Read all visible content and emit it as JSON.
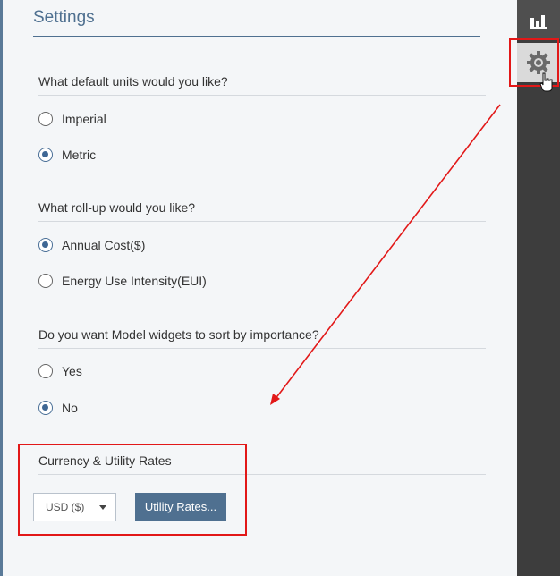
{
  "settings": {
    "title": "Settings",
    "units": {
      "question": "What default units would you like?",
      "options": [
        {
          "label": "Imperial",
          "selected": false
        },
        {
          "label": "Metric",
          "selected": true
        }
      ]
    },
    "rollup": {
      "question": "What roll-up would you like?",
      "options": [
        {
          "label": "Annual Cost($)",
          "selected": true
        },
        {
          "label": "Energy Use Intensity(EUI)",
          "selected": false
        }
      ]
    },
    "sort": {
      "question": "Do you want Model widgets to sort by importance?",
      "options": [
        {
          "label": "Yes",
          "selected": false
        },
        {
          "label": "No",
          "selected": true
        }
      ]
    },
    "currency": {
      "heading": "Currency & Utility Rates",
      "selected_value": "USD ($)",
      "rates_button": "Utility Rates..."
    }
  },
  "sidebar": {
    "icons": [
      "bar-chart-icon",
      "gear-icon"
    ],
    "active": "gear-icon"
  },
  "colors": {
    "accent": "#4f7090",
    "highlight": "#e21818",
    "rail": "#3d3d3d"
  }
}
